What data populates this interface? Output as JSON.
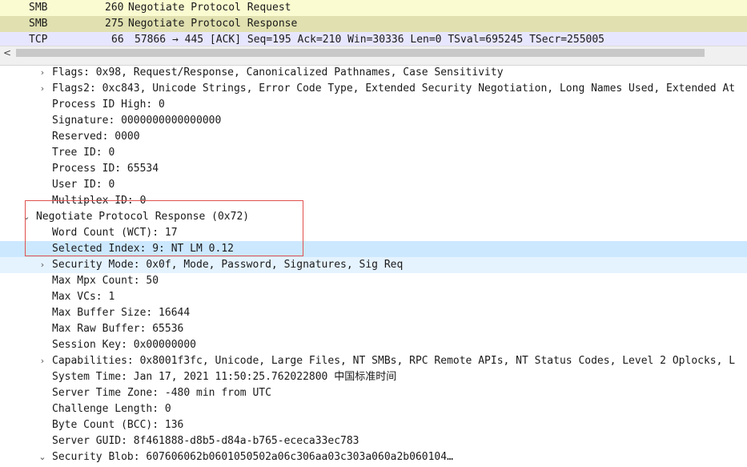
{
  "packets": [
    {
      "proto": "SMB",
      "len": "260",
      "info": "Negotiate Protocol Request",
      "bg": "#fbfbd1"
    },
    {
      "proto": "SMB",
      "len": "275",
      "info": "Negotiate Protocol Response",
      "bg": "#e0e0b0"
    },
    {
      "proto": "TCP",
      "len": "66",
      "info": "57866 → 445 [ACK] Seq=195 Ack=210 Win=30336 Len=0 TSval=695245 TSecr=255005",
      "bg": "#e7e6ff"
    }
  ],
  "scroll_left_glyph": "<",
  "tree": [
    {
      "text": "Flags: 0x98, Request/Response, Canonicalized Pathnames, Case Sensitivity",
      "indent": 1,
      "exp": "›"
    },
    {
      "text": "Flags2: 0xc843, Unicode Strings, Error Code Type, Extended Security Negotiation, Long Names Used, Extended At",
      "indent": 1,
      "exp": "›"
    },
    {
      "text": "Process ID High: 0",
      "indent": 1,
      "exp": ""
    },
    {
      "text": "Signature: 0000000000000000",
      "indent": 1,
      "exp": ""
    },
    {
      "text": "Reserved: 0000",
      "indent": 1,
      "exp": ""
    },
    {
      "text": "Tree ID: 0",
      "indent": 1,
      "exp": ""
    },
    {
      "text": "Process ID: 65534",
      "indent": 1,
      "exp": ""
    },
    {
      "text": "User ID: 0",
      "indent": 1,
      "exp": ""
    },
    {
      "text": "Multiplex ID: 0",
      "indent": 1,
      "exp": ""
    },
    {
      "text": "Negotiate Protocol Response (0x72)",
      "indent": 0,
      "exp": "⌄"
    },
    {
      "text": "Word Count (WCT): 17",
      "indent": 1,
      "exp": ""
    },
    {
      "text": "Selected Index: 9: NT LM 0.12",
      "indent": 1,
      "exp": "",
      "selected": true
    },
    {
      "text": "Security Mode: 0x0f, Mode, Password, Signatures, Sig Req",
      "indent": 1,
      "exp": "›",
      "related": true
    },
    {
      "text": "Max Mpx Count: 50",
      "indent": 1,
      "exp": ""
    },
    {
      "text": "Max VCs: 1",
      "indent": 1,
      "exp": ""
    },
    {
      "text": "Max Buffer Size: 16644",
      "indent": 1,
      "exp": ""
    },
    {
      "text": "Max Raw Buffer: 65536",
      "indent": 1,
      "exp": ""
    },
    {
      "text": "Session Key: 0x00000000",
      "indent": 1,
      "exp": ""
    },
    {
      "text": "Capabilities: 0x8001f3fc, Unicode, Large Files, NT SMBs, RPC Remote APIs, NT Status Codes, Level 2 Oplocks, L",
      "indent": 1,
      "exp": "›"
    },
    {
      "text": "System Time: Jan 17, 2021 11:50:25.762022800 中国标准时间",
      "indent": 1,
      "exp": ""
    },
    {
      "text": "Server Time Zone: -480 min from UTC",
      "indent": 1,
      "exp": ""
    },
    {
      "text": "Challenge Length: 0",
      "indent": 1,
      "exp": ""
    },
    {
      "text": "Byte Count (BCC): 136",
      "indent": 1,
      "exp": ""
    },
    {
      "text": "Server GUID: 8f461888-d8b5-d84a-b765-ececa33ec783",
      "indent": 1,
      "exp": ""
    },
    {
      "text": "Security Blob: 607606062b0601050502a06c306aa03c303a060a2b060104…",
      "indent": 1,
      "exp": "⌄"
    }
  ],
  "colors": {
    "selected": "#cce8ff",
    "related": "#e5f3ff",
    "annotation_box": "#e0504d"
  }
}
